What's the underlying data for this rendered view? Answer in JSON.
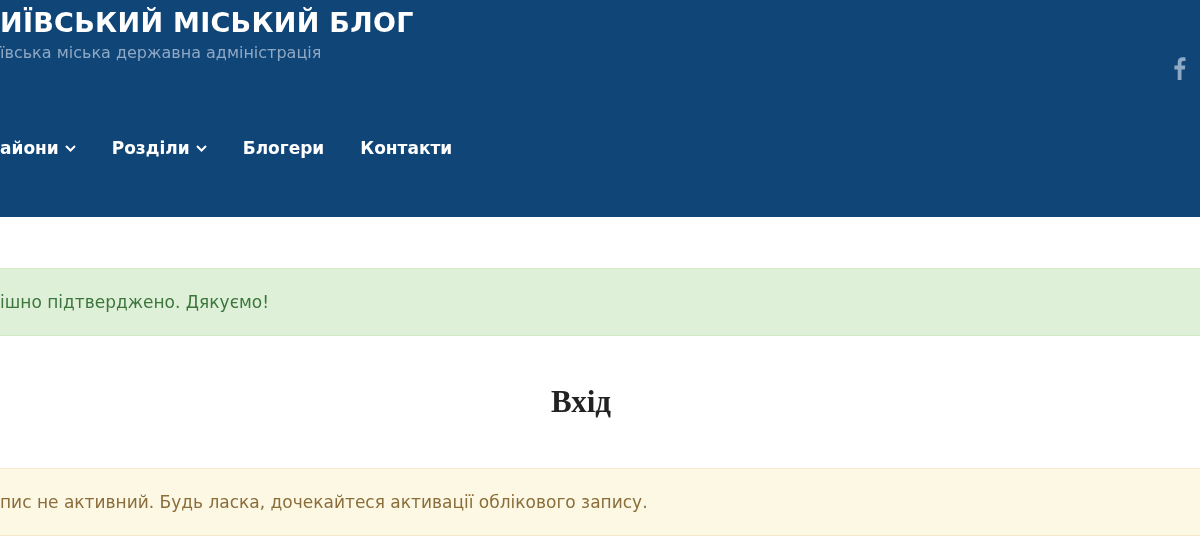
{
  "header": {
    "site_title": "ИЇВСЬКИЙ МІСЬКИЙ БЛОГ",
    "tagline": "ївська міська державна адміністрація"
  },
  "nav": [
    {
      "label": "айони",
      "dropdown": true
    },
    {
      "label": "Розділи",
      "dropdown": true
    },
    {
      "label": "Блогери",
      "dropdown": false
    },
    {
      "label": "Контакти",
      "dropdown": false
    }
  ],
  "notices_top": [
    {
      "kind": "success",
      "text": "ішно підтверджено. Дякуємо!"
    }
  ],
  "heading": "Вхід",
  "notices_bottom": [
    {
      "kind": "warning",
      "text": "пис не активний. Будь ласка, дочекайтеся активації облікового запису."
    }
  ]
}
